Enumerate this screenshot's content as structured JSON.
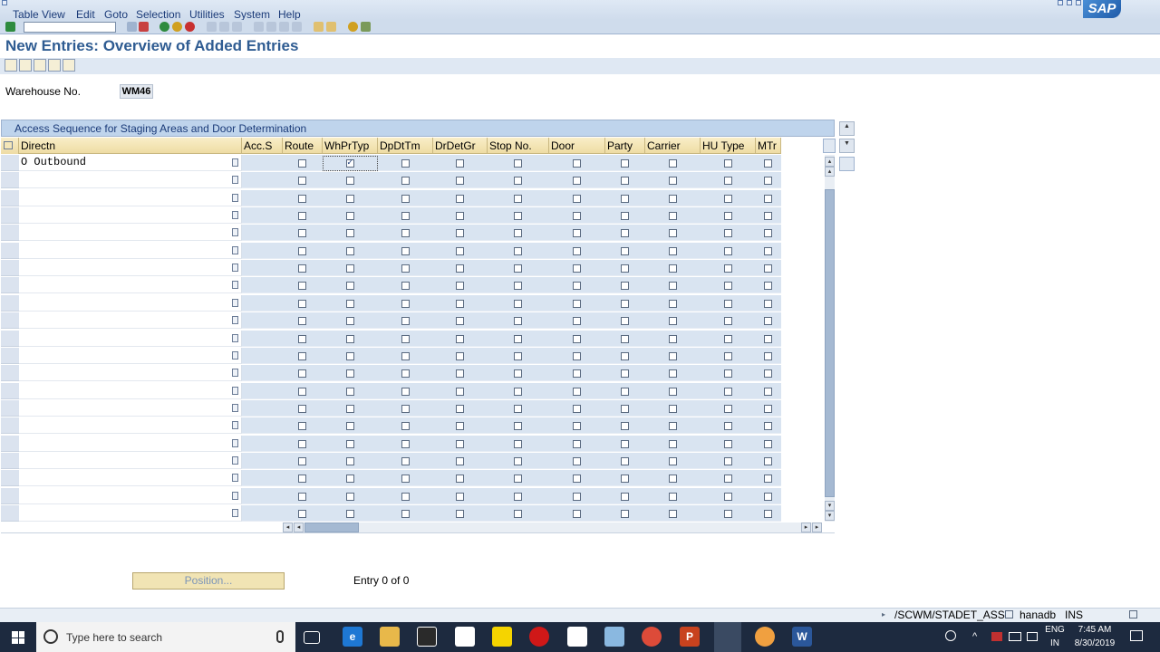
{
  "menu": [
    "Table View",
    "Edit",
    "Goto",
    "Selection",
    "Utilities",
    "System",
    "Help"
  ],
  "page_title": "New Entries: Overview of Added Entries",
  "warehouse": {
    "label": "Warehouse No.",
    "value": "WM46"
  },
  "table": {
    "title": "Access Sequence for Staging Areas and Door Determination",
    "columns": [
      "Directn",
      "Acc.S",
      "Route",
      "WhPrTyp",
      "DpDtTm",
      "DrDetGr",
      "Stop No.",
      "Door",
      "Party",
      "Carrier",
      "HU Type",
      "MTr"
    ],
    "first_row_value": "O Outbound",
    "row_count": 21,
    "checked": [
      {
        "row": 0,
        "col": "WhPrTyp"
      }
    ]
  },
  "position_button": "Position...",
  "entry_info": "Entry 0 of 0",
  "status": {
    "program": "/SCWM/STADET_ASS",
    "server": "hanadb",
    "mode": "INS"
  },
  "taskbar": {
    "search_placeholder": "Type here to search",
    "lang1": "ENG",
    "lang2": "IN",
    "time": "7:45 AM",
    "date": "8/30/2019"
  }
}
